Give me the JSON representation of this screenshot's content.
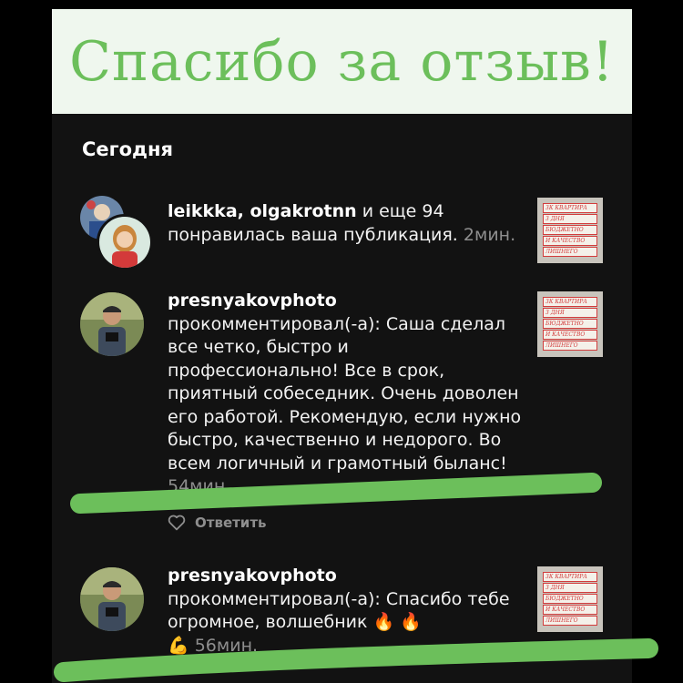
{
  "banner": {
    "title": "Спасибо за отзыв!"
  },
  "section": {
    "title": "Сегодня"
  },
  "notifications": [
    {
      "users": "leikkka, olgakrotnn",
      "users_suffix": " и еще 94",
      "text": "понравилась ваша публикация.",
      "time": "2мин."
    },
    {
      "user": "presnyakovphoto",
      "text": "прокомментировал(-а): Саша сделал все четко, быстро и профессионально! Все в срок, приятный собеседник. Очень доволен его работой. Рекомендую, если нужно быстро, качественно и недорого. Во всем логичный и грамотный быланс!",
      "time": "54мин.",
      "reply_label": "Ответить"
    },
    {
      "user": "presnyakovphoto",
      "text": "прокомментировал(-а): Спасибо тебе огромное, волшебник",
      "emoji_fire": "🔥 🔥",
      "emoji_muscle": "💪",
      "time": "56мин."
    }
  ],
  "thumbnail": {
    "lines": [
      "3К КВАРТИРА",
      "3 ДНЯ",
      "БЮДЖЕТНО",
      "И КАЧЕСТВО",
      "ЛИШНЕГО"
    ]
  },
  "colors": {
    "highlight": "#6cbf5b",
    "banner_bg": "#eff7ee",
    "feed_bg": "#121212",
    "muted_text": "#8e8e8e"
  },
  "icons": {
    "reply_heart": "heart-outline-icon",
    "fire": "fire-emoji-icon",
    "muscle": "flexed-biceps-emoji-icon"
  }
}
